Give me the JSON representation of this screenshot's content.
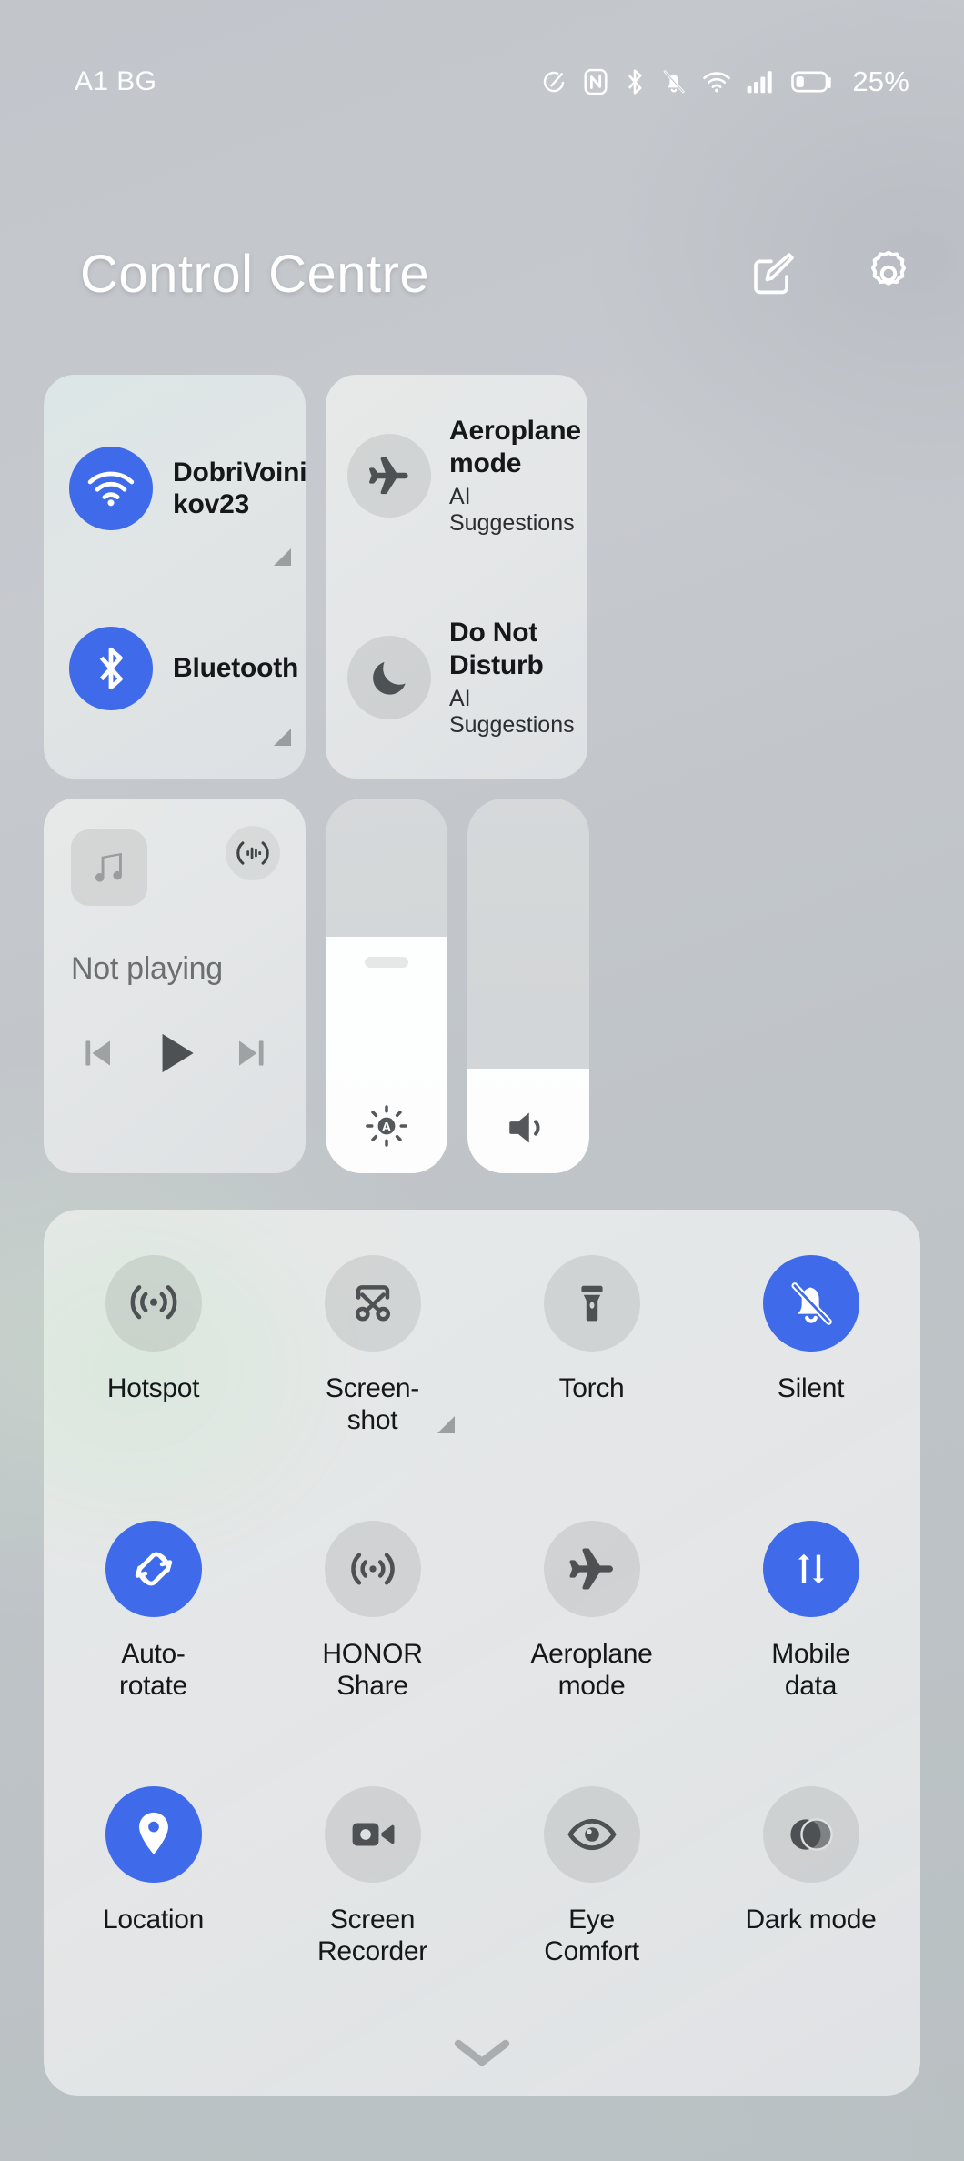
{
  "statusbar": {
    "carrier": "A1 BG",
    "battery_percent": "25%",
    "icons": [
      "data-saver-icon",
      "nfc-icon",
      "bluetooth-icon",
      "silent-bell-icon",
      "wifi-icon",
      "signal-bars-icon",
      "battery-icon"
    ]
  },
  "header": {
    "title": "Control Centre",
    "edit_icon": "edit-pencil-square-icon",
    "settings_icon": "gear-icon"
  },
  "connectivity": {
    "wifi": {
      "label": "DobriVoinikov23",
      "line1": "DobriVoini",
      "line2": "kov23",
      "state": "on",
      "icon": "wifi-icon"
    },
    "bluetooth": {
      "label": "Bluetooth",
      "state": "on",
      "icon": "bluetooth-icon"
    },
    "aeroplane": {
      "label": "Aeroplane mode",
      "line1": "Aeroplane",
      "line2": "mode",
      "sub1": "AI",
      "sub2": "Suggestions",
      "state": "off",
      "icon": "aeroplane-icon"
    },
    "dnd": {
      "label": "Do Not Disturb",
      "line1": "Do Not",
      "line2": "Disturb",
      "sub1": "AI",
      "sub2": "Suggestions",
      "state": "off",
      "icon": "moon-icon"
    }
  },
  "media": {
    "now_playing": "Not playing",
    "album_art_icon": "music-note-icon",
    "cast_icon": "audio-output-icon",
    "prev_icon": "skip-previous-icon",
    "play_icon": "play-icon",
    "next_icon": "skip-next-icon"
  },
  "sliders": {
    "brightness": {
      "name": "brightness",
      "value": 63,
      "icon": "auto-brightness-icon"
    },
    "volume": {
      "name": "volume",
      "value": 28,
      "icon": "speaker-icon"
    }
  },
  "toggles": [
    {
      "label": "Hotspot",
      "line1": "Hotspot",
      "line2": "",
      "state": "off",
      "icon": "hotspot-icon",
      "expandable": false
    },
    {
      "label": "Screenshot",
      "line1": "Screen-",
      "line2": "shot",
      "state": "off",
      "icon": "screenshot-icon",
      "expandable": true
    },
    {
      "label": "Torch",
      "line1": "Torch",
      "line2": "",
      "state": "off",
      "icon": "torch-icon",
      "expandable": false
    },
    {
      "label": "Silent",
      "line1": "Silent",
      "line2": "",
      "state": "on",
      "icon": "silent-bell-icon",
      "expandable": false
    },
    {
      "label": "Auto-rotate",
      "line1": "Auto-",
      "line2": "rotate",
      "state": "on",
      "icon": "auto-rotate-icon",
      "expandable": false
    },
    {
      "label": "HONOR Share",
      "line1": "HONOR",
      "line2": "Share",
      "state": "off",
      "icon": "honor-share-icon",
      "expandable": false
    },
    {
      "label": "Aeroplane mode",
      "line1": "Aeroplane",
      "line2": "mode",
      "state": "off",
      "icon": "aeroplane-icon",
      "expandable": false
    },
    {
      "label": "Mobile data",
      "line1": "Mobile",
      "line2": "data",
      "state": "on",
      "icon": "mobile-data-icon",
      "expandable": false
    },
    {
      "label": "Location",
      "line1": "Location",
      "line2": "",
      "state": "on",
      "icon": "location-pin-icon",
      "expandable": false
    },
    {
      "label": "Screen Recorder",
      "line1": "Screen",
      "line2": "Recorder",
      "state": "off",
      "icon": "screen-recorder-icon",
      "expandable": false
    },
    {
      "label": "Eye Comfort",
      "line1": "Eye",
      "line2": "Comfort",
      "state": "off",
      "icon": "eye-icon",
      "expandable": false
    },
    {
      "label": "Dark mode",
      "line1": "Dark mode",
      "line2": "",
      "state": "off",
      "icon": "dark-mode-icon",
      "expandable": false
    }
  ],
  "collapse": {
    "icon": "chevron-down-icon"
  },
  "colors": {
    "accent_on": "#3f6bea",
    "tile_off": "rgba(0,0,0,0.085)",
    "label_text": "#15171a",
    "muted_text": "#6d7073"
  }
}
